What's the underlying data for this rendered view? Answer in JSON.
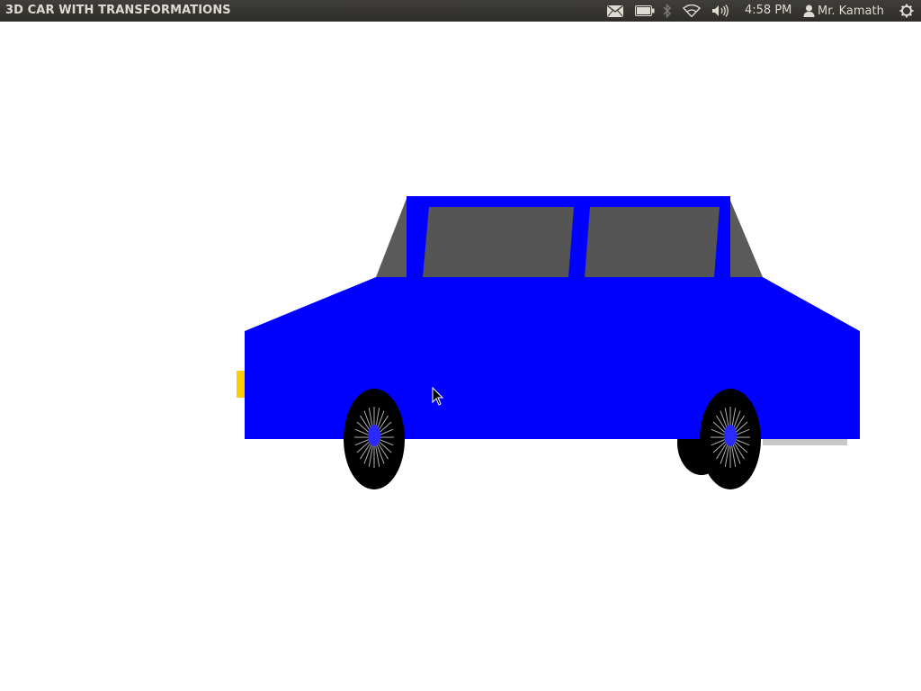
{
  "window": {
    "title": "3D CAR WITH TRANSFORMATIONS"
  },
  "panel": {
    "indicators": [
      {
        "icon": "mail-icon"
      },
      {
        "icon": "battery-icon"
      },
      {
        "icon": "bluetooth-icon"
      },
      {
        "icon": "wifi-icon"
      },
      {
        "icon": "volume-icon"
      }
    ],
    "clock": "4:58 PM",
    "user_name": "Mr. Kamath",
    "user_icon": "user-icon",
    "session_icon": "power-gear-icon"
  },
  "scene": {
    "background": "#ffffff",
    "car_body_color": "#0000ff",
    "window_color": "#555555",
    "pillar_color": "#5a5a5a",
    "tail_light_color": "#ffcc00",
    "tire_color": "#000000",
    "spoke_color": "#b0b0b0",
    "hub_color": "#2a2aff",
    "bumper_color": "#c8c8c8"
  }
}
